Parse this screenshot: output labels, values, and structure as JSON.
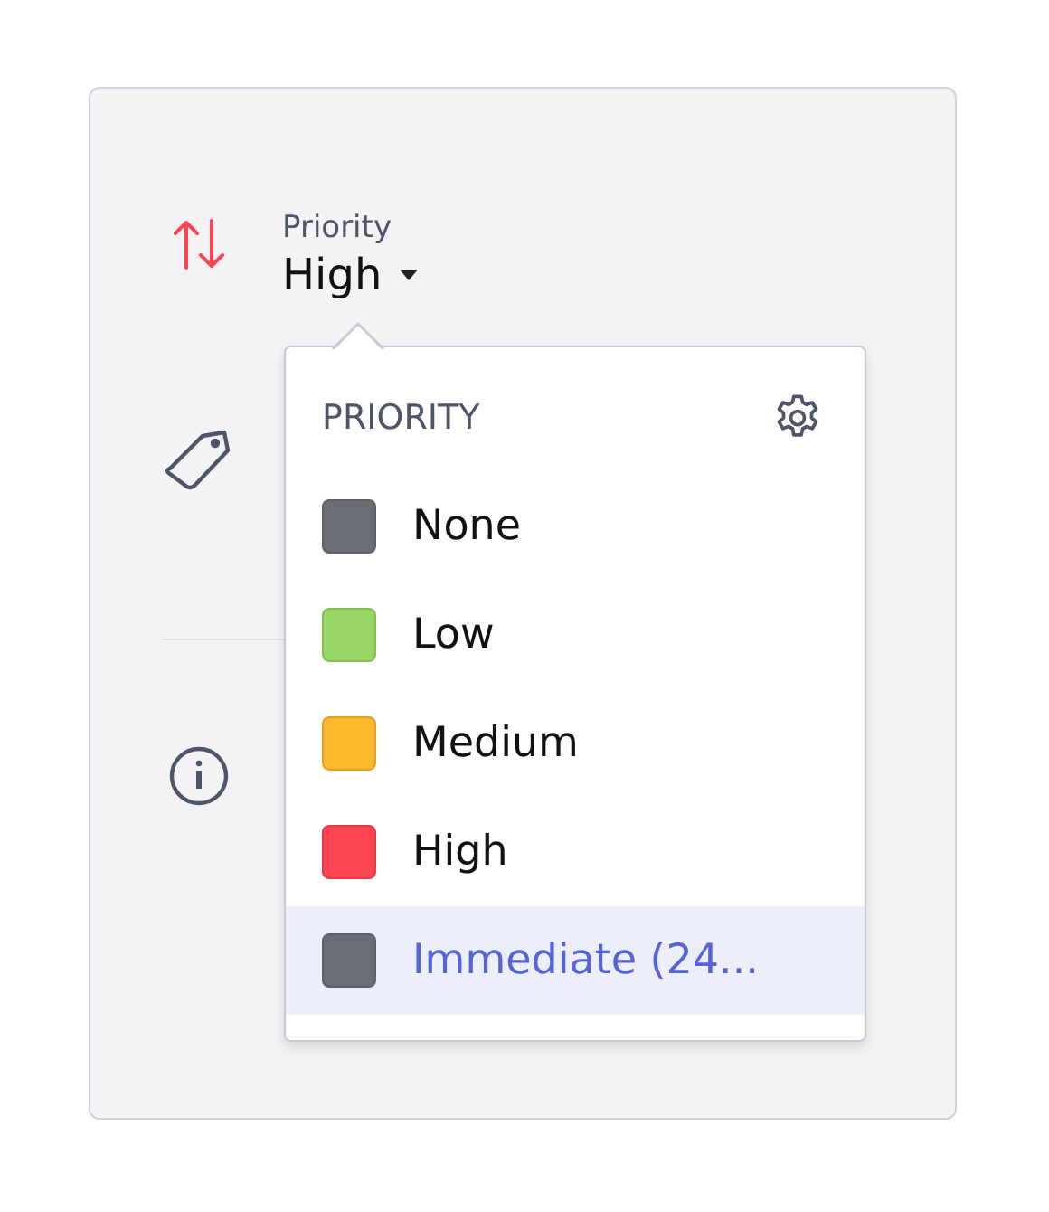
{
  "field": {
    "label": "Priority",
    "value": "High"
  },
  "dropdown": {
    "title": "PRIORITY",
    "options": [
      {
        "label": "None",
        "color": "#6b6d75",
        "selected": false
      },
      {
        "label": "Low",
        "color": "#99d866",
        "selected": false
      },
      {
        "label": "Medium",
        "color": "#fdb92c",
        "selected": false
      },
      {
        "label": "High",
        "color": "#fd4452",
        "selected": false
      },
      {
        "label": "Immediate (24...",
        "color": "#6b6d75",
        "selected": true
      }
    ]
  }
}
